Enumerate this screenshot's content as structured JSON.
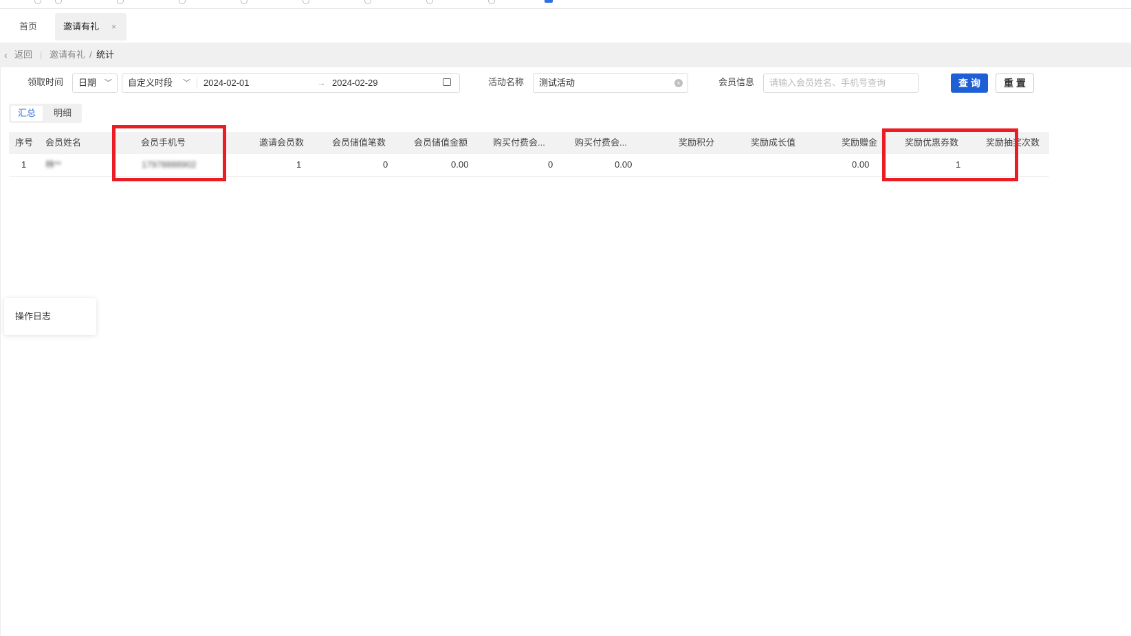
{
  "tabs": {
    "home": "首页",
    "active": "邀请有礼",
    "close_icon": "×"
  },
  "breadcrumb": {
    "back": "返回",
    "parent": "邀请有礼",
    "separator": "/",
    "current": "统计"
  },
  "filters": {
    "receive_time_label": "领取时间",
    "date_type": "日期",
    "period_type": "自定义时段",
    "start_date": "2024-02-01",
    "arrow": "→",
    "end_date": "2024-02-29",
    "activity_label": "活动名称",
    "activity_value": "测试活动",
    "member_label": "会员信息",
    "member_placeholder": "请输入会员姓名、手机号查询",
    "query_button": "查 询",
    "reset_button": "重 置"
  },
  "view_tabs": {
    "summary": "汇总",
    "detail": "明细"
  },
  "table": {
    "columns": [
      "序号",
      "会员姓名",
      "会员手机号",
      "邀请会员数",
      "会员储值笔数",
      "会员储值金额",
      "购买付费会...",
      "购买付费会...",
      "奖励积分",
      "奖励成长值",
      "奖励赠金",
      "奖励优惠券数",
      "奖励抽奖次数"
    ],
    "rows": [
      {
        "index": "1",
        "name": "林**",
        "phone": "17978888902",
        "invited": "1",
        "stored_count": "0",
        "stored_amount": "0.00",
        "paid_member_1": "0",
        "paid_member_2": "0.00",
        "points": "",
        "growth": "",
        "bonus": "0.00",
        "coupons": "1",
        "lottery": ""
      }
    ]
  },
  "side_panel": {
    "operation_log": "操作日志"
  },
  "colors": {
    "primary": "#1f5fd6",
    "highlight_box": "#ec1c24",
    "active_tab_text": "#2f6fe0"
  }
}
